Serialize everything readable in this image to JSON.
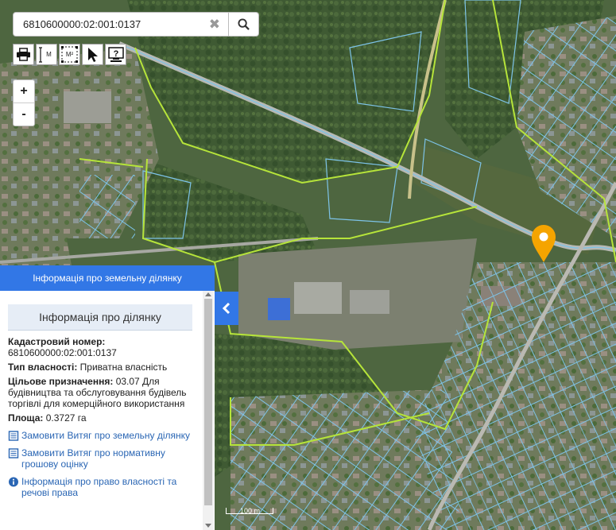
{
  "search": {
    "value": "6810600000:02:001:0137",
    "clear_icon": "close-icon",
    "search_icon": "search-icon"
  },
  "toolbar": {
    "tools": [
      {
        "name": "print",
        "icon": "printer-icon"
      },
      {
        "name": "measure-length",
        "icon": "ruler-icon",
        "label": "M"
      },
      {
        "name": "measure-area",
        "icon": "area-icon",
        "label": "M²"
      },
      {
        "name": "select",
        "icon": "cursor-icon"
      },
      {
        "name": "help",
        "icon": "help-icon"
      }
    ]
  },
  "zoom": {
    "in": "+",
    "out": "-"
  },
  "panel": {
    "header": "Інформація про земельну ділянку",
    "subtitle": "Інформація про ділянку",
    "cadastral_label": "Кадастровий номер:",
    "cadastral_value": "6810600000:02:001:0137",
    "ownership_label": "Тип власності:",
    "ownership_value": "Приватна власність",
    "purpose_label": "Цільове призначення:",
    "purpose_value": "03.07 Для будівництва та обслуговування будівель торгівлі для комерційного використання",
    "area_label": "Площа:",
    "area_value": "0.3727 га",
    "link_extract": "Замовити Витяг про земельну ділянку",
    "link_valuation": "Замовити Витяг про нормативну грошову оцінку",
    "link_rights": "Інформація про право власності та речові права"
  },
  "scale": "100 m",
  "colors": {
    "accent": "#3277e6",
    "parcel": "#7dc3e8",
    "boundary": "#b6e43a",
    "marker": "#f5a400",
    "link": "#2a66b4"
  }
}
